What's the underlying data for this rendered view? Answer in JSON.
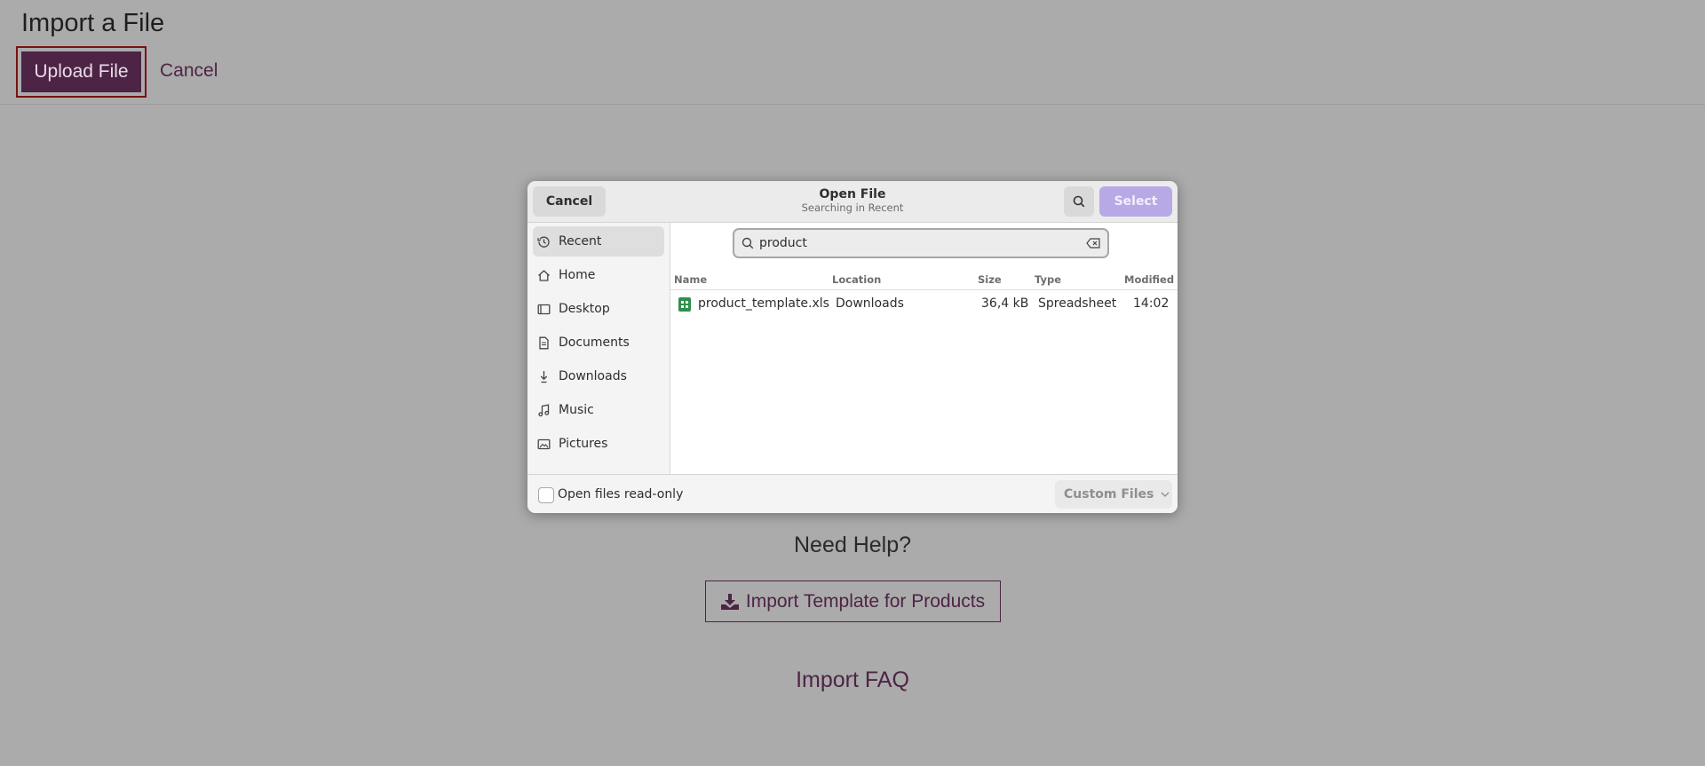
{
  "page": {
    "title": "Import a File",
    "upload_label": "Upload File",
    "cancel_label": "Cancel",
    "help_title": "Need Help?",
    "template_label": "Import Template for Products",
    "faq_label": "Import FAQ"
  },
  "dialog": {
    "cancel_label": "Cancel",
    "title": "Open File",
    "subtitle": "Searching in Recent",
    "select_label": "Select",
    "sidebar": [
      {
        "label": "Recent",
        "icon": "clock-icon",
        "active": true
      },
      {
        "label": "Home",
        "icon": "home-icon",
        "active": false
      },
      {
        "label": "Desktop",
        "icon": "desktop-icon",
        "active": false
      },
      {
        "label": "Documents",
        "icon": "document-icon",
        "active": false
      },
      {
        "label": "Downloads",
        "icon": "download-icon",
        "active": false
      },
      {
        "label": "Music",
        "icon": "music-icon",
        "active": false
      },
      {
        "label": "Pictures",
        "icon": "picture-icon",
        "active": false
      }
    ],
    "search_value": "product",
    "columns": {
      "name": "Name",
      "location": "Location",
      "size": "Size",
      "type": "Type",
      "modified": "Modified"
    },
    "files": [
      {
        "name": "product_template.xls",
        "location": "Downloads",
        "size": "36,4 kB",
        "type": "Spreadsheet",
        "modified": "14:02",
        "icon": "spreadsheet-icon"
      }
    ],
    "readonly_label": "Open files read-only",
    "filter_label": "Custom Files"
  },
  "colors": {
    "brand": "#4d2446",
    "select_button": "#b8a9e6",
    "overlay": "#ababab",
    "spreadsheet_icon": "#2f8f4e"
  }
}
